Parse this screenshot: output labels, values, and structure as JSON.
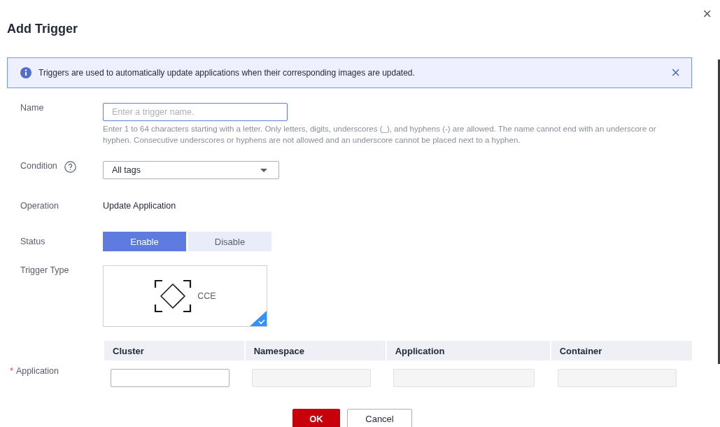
{
  "dialog": {
    "title": "Add Trigger",
    "close": "×"
  },
  "banner": {
    "text": "Triggers are used to automatically update applications when their corresponding images are updated.",
    "close": "×"
  },
  "form": {
    "name": {
      "label": "Name",
      "placeholder": "Enter a trigger name.",
      "focused": true,
      "hint": "Enter 1 to 64 characters starting with a letter. Only letters, digits, underscores (_), and hyphens (-) are allowed. The name cannot end with an underscore or hyphen. Consecutive underscores or hyphens are not allowed and an underscore cannot be placed next to a hyphen."
    },
    "condition": {
      "label": "Condition",
      "value": "All tags"
    },
    "operation": {
      "label": "Operation",
      "value": "Update Application"
    },
    "status": {
      "label": "Status",
      "options": [
        {
          "label": "Enable",
          "selected": true
        },
        {
          "label": "Disable",
          "selected": false
        }
      ]
    },
    "trigger_type": {
      "label": "Trigger Type",
      "options": [
        {
          "label": "CCE",
          "selected": true
        }
      ]
    },
    "application": {
      "label": "Application",
      "required_mark": "*",
      "columns": [
        "Cluster",
        "Namespace",
        "Application",
        "Container"
      ],
      "fields": [
        {
          "disabled": false
        },
        {
          "disabled": true
        },
        {
          "disabled": true
        },
        {
          "disabled": true
        }
      ]
    }
  },
  "buttons": [
    {
      "label": "OK",
      "kind": "primary"
    },
    {
      "label": "Cancel",
      "kind": "secondary"
    }
  ]
}
